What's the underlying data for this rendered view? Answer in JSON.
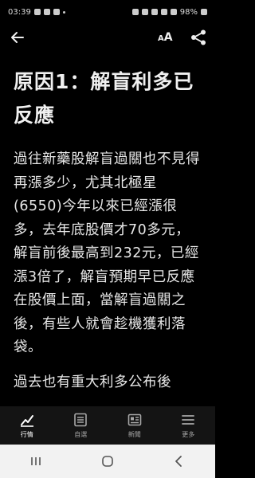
{
  "status_bar": {
    "time": "03:39",
    "battery": "98%"
  },
  "top_bar": {
    "font_size_label_small": "A",
    "font_size_label_large": "A"
  },
  "article": {
    "title": "原因1：解盲利多已反應",
    "paragraphs": [
      "過往新藥股解盲過關也不見得再漲多少，尤其北極星(6550)今年以來已經漲很多，去年底股價才70多元，解盲前後最高到232元，已經漲3倍了，解盲預期早已反應在股價上面，當解盲過關之後，有些人就會趁機獲利落袋。",
      "過去也有重大利多公布後"
    ]
  },
  "bottom_nav": {
    "items": [
      {
        "label": "行情",
        "icon": "chart-icon"
      },
      {
        "label": "自選",
        "icon": "list-icon"
      },
      {
        "label": "新聞",
        "icon": "news-icon"
      },
      {
        "label": "更多",
        "icon": "menu-icon"
      }
    ]
  },
  "system_nav": {
    "icons": [
      "recent-apps-icon",
      "home-icon",
      "back-icon"
    ]
  }
}
